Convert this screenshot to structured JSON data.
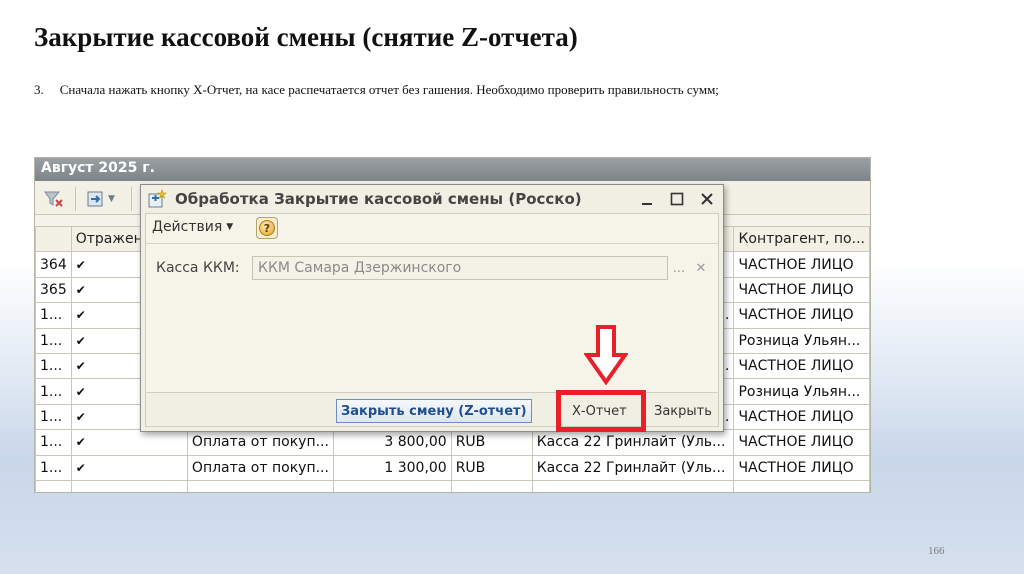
{
  "slide": {
    "title": "Закрытие кассовой смены (снятие Z-отчета)",
    "step_number": "3.",
    "step_text": "Сначала нажать кнопку Х-Отчет, на касе распечатается отчет без гашения. Необходимо проверить правильность сумм;",
    "page_number": "166"
  },
  "background_window": {
    "header": "Август 2025 г.",
    "columns": [
      "",
      "Отражен",
      "",
      "",
      "",
      "",
      "Контрагент, по..."
    ],
    "rows": [
      {
        "num": "364",
        "check": "✔",
        "op": "",
        "sum": "",
        "cur": "",
        "kassa": "",
        "kontragent": "ЧАСТНОЕ ЛИЦО"
      },
      {
        "num": "365",
        "check": "✔",
        "op": "",
        "sum": "",
        "cur": "",
        "kassa": "",
        "kontragent": "ЧАСТНОЕ ЛИЦО"
      },
      {
        "num": "1...",
        "check": "✔",
        "op": "",
        "sum": "",
        "cur": "",
        "kassa": ".",
        "kontragent": "ЧАСТНОЕ ЛИЦО"
      },
      {
        "num": "1...",
        "check": "✔",
        "op": "",
        "sum": "",
        "cur": "",
        "kassa": "",
        "kontragent": "Розница Ульян..."
      },
      {
        "num": "1...",
        "check": "✔",
        "op": "",
        "sum": "",
        "cur": "",
        "kassa": ".",
        "kontragent": "ЧАСТНОЕ ЛИЦО"
      },
      {
        "num": "1...",
        "check": "✔",
        "op": "",
        "sum": "",
        "cur": "",
        "kassa": "",
        "kontragent": "Розница Ульян..."
      },
      {
        "num": "1...",
        "check": "✔",
        "op": "",
        "sum": "",
        "cur": "",
        "kassa": ".",
        "kontragent": "ЧАСТНОЕ ЛИЦО"
      },
      {
        "num": "1...",
        "check": "✔",
        "op": "Оплата от покуп...",
        "sum": "3 800,00",
        "cur": "RUB",
        "kassa": "Касса 22 Гринлайт (Уль...",
        "kontragent": "ЧАСТНОЕ ЛИЦО"
      },
      {
        "num": "1...",
        "check": "✔",
        "op": "Оплата от покуп...",
        "sum": "1 300,00",
        "cur": "RUB",
        "kassa": "Касса 22 Гринлайт (Уль...",
        "kontragent": "ЧАСТНОЕ ЛИЦО"
      },
      {
        "num": "",
        "check": "",
        "op": "",
        "sum": "",
        "cur": "",
        "kassa": "",
        "kontragent": ""
      }
    ]
  },
  "dialog": {
    "title": "Обработка  Закрытие кассовой смены (Росско)",
    "menu_actions": "Действия",
    "help_symbol": "?",
    "field_label": "Касса ККМ:",
    "field_value": "ККМ Самара Дзержинского",
    "btn_dots": "...",
    "btn_clear": "✕",
    "btn_close_shift": "Закрыть смену (Z-отчет)",
    "btn_x_report": "Х-Отчет",
    "btn_close": "Закрыть"
  },
  "colors": {
    "highlight": "#e8202b",
    "close_shift_text": "#1f4f8f"
  }
}
